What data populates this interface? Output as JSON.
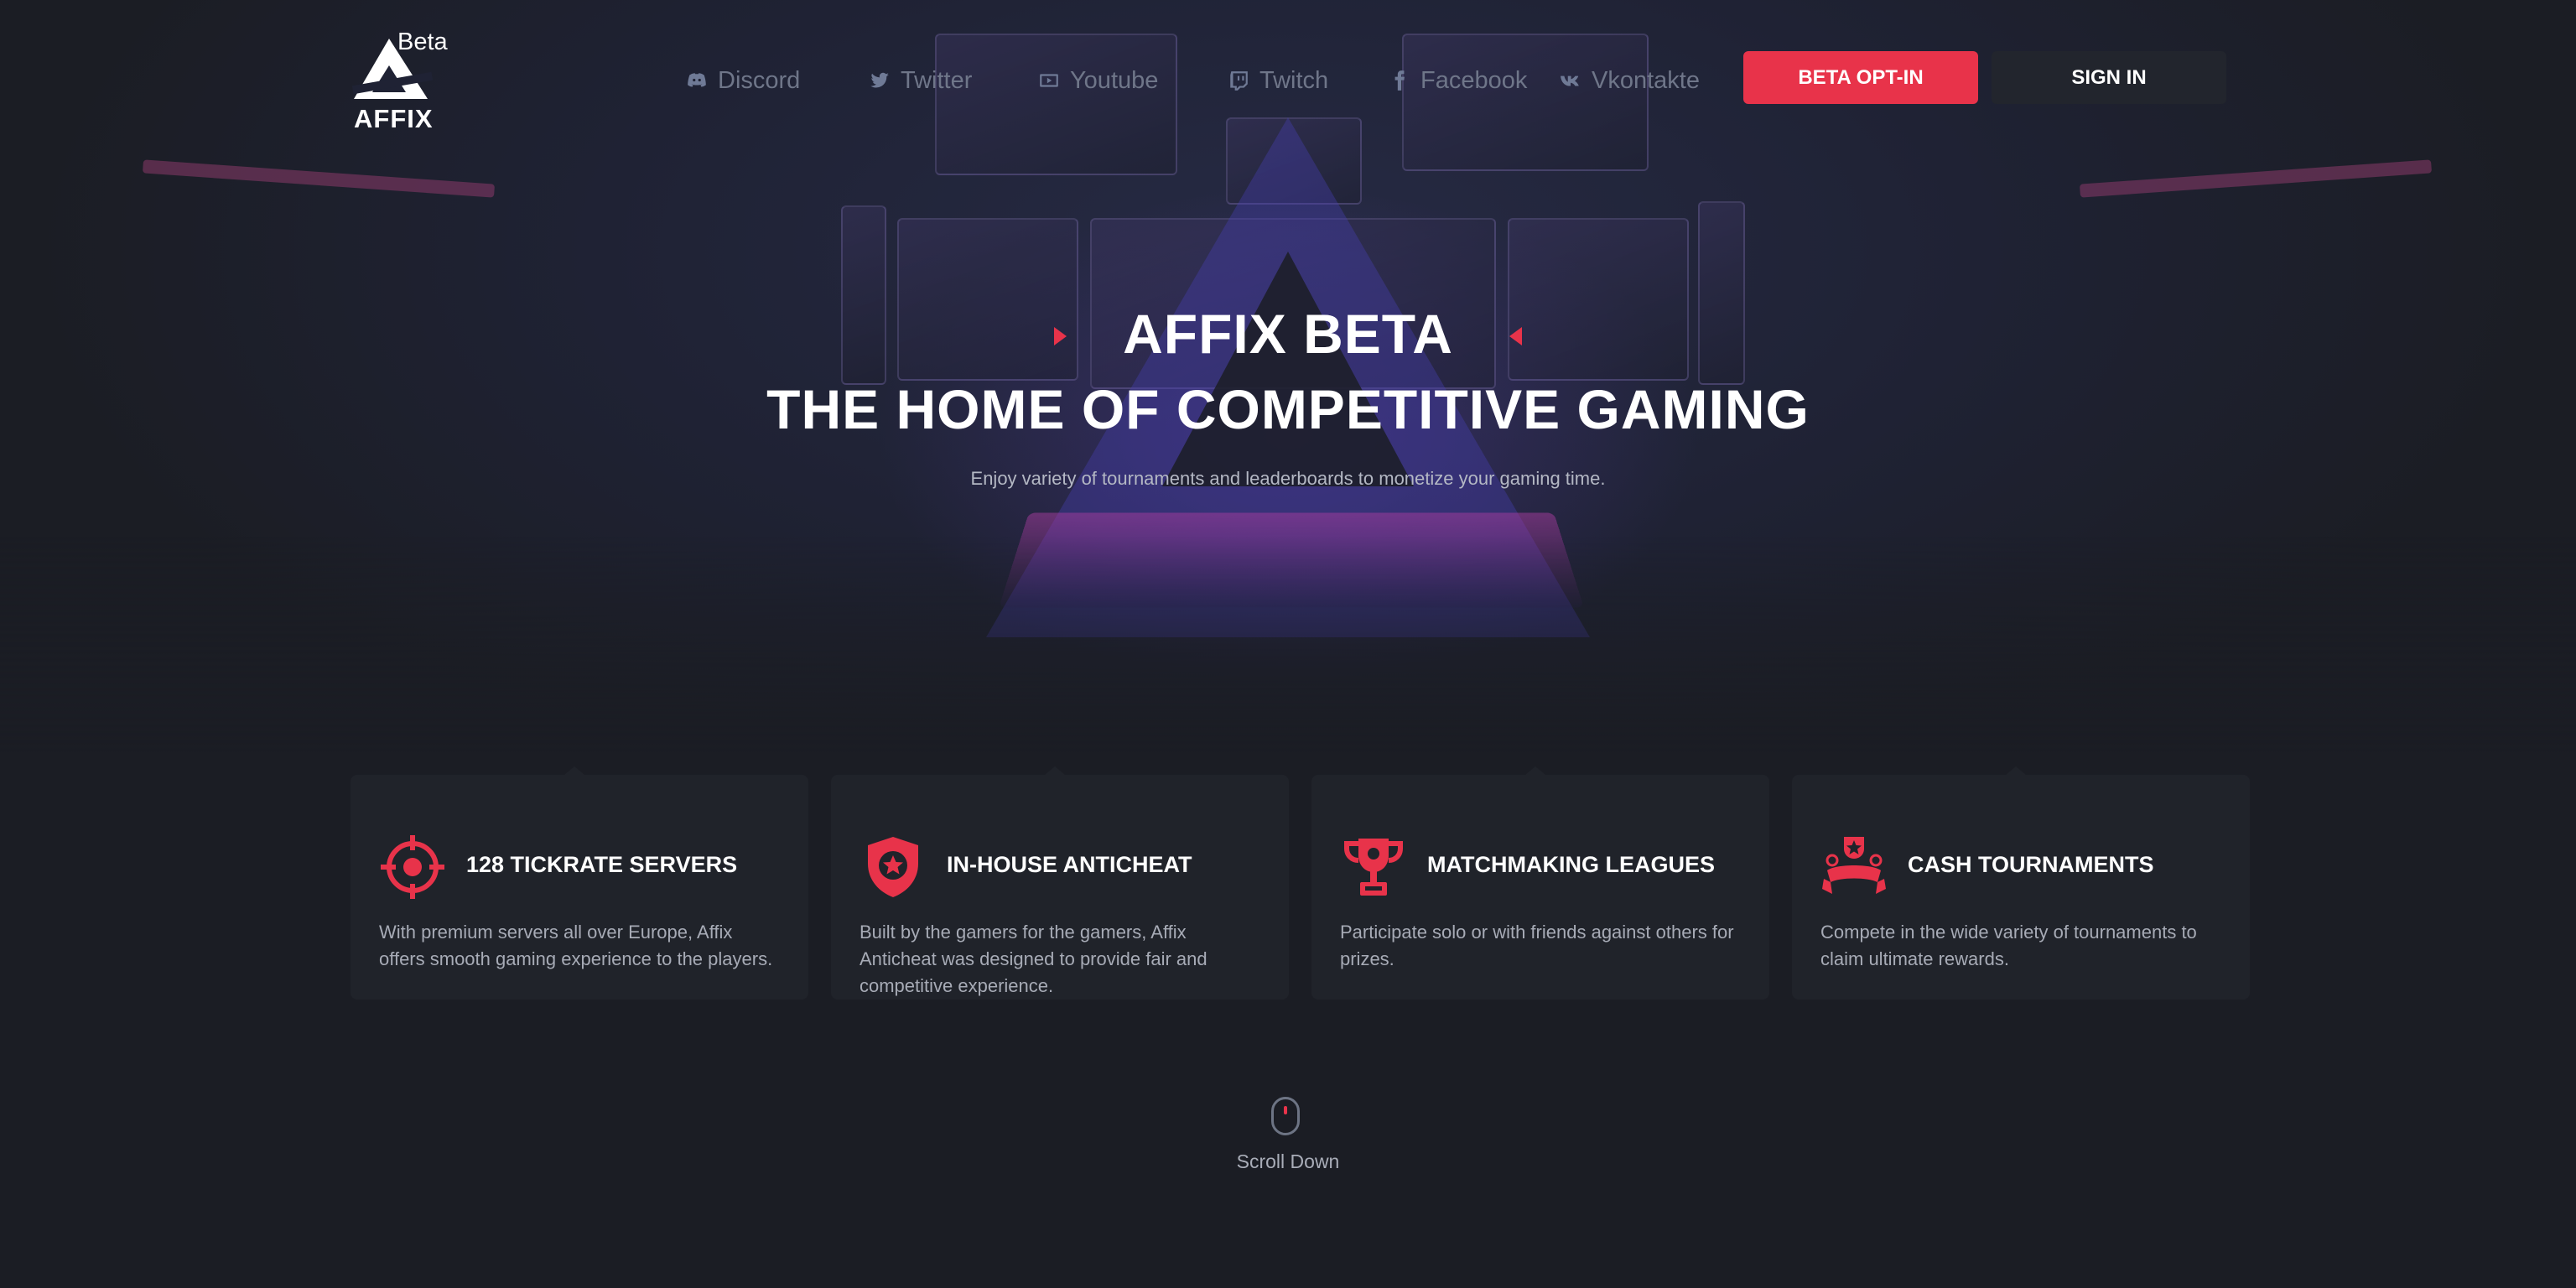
{
  "header": {
    "logo_beta": "Beta",
    "logo_text": "AFFIX",
    "nav": [
      {
        "label": "Discord",
        "icon": "discord-icon"
      },
      {
        "label": "Twitter",
        "icon": "twitter-icon"
      },
      {
        "label": "Youtube",
        "icon": "youtube-icon"
      },
      {
        "label": "Twitch",
        "icon": "twitch-icon"
      },
      {
        "label": "Facebook",
        "icon": "facebook-icon"
      },
      {
        "label": "Vkontakte",
        "icon": "vk-icon"
      }
    ],
    "optin_label": "BETA OPT-IN",
    "signin_label": "SIGN IN"
  },
  "hero": {
    "title_line1": "AFFIX BETA",
    "title_line2": "THE HOME OF COMPETITIVE GAMING",
    "subtitle": "Enjoy variety of tournaments and leaderboards to monetize your gaming time."
  },
  "features": [
    {
      "icon": "crosshair-icon",
      "title": "128 TICKRATE SERVERS",
      "desc": "With premium servers all over Europe, Affix offers smooth gaming experience to the players."
    },
    {
      "icon": "shield-star-icon",
      "title": "IN-HOUSE ANTICHEAT",
      "desc": "Built by the gamers for the gamers, Affix Anticheat was designed to provide fair and competitive experience."
    },
    {
      "icon": "trophy-icon",
      "title": "MATCHMAKING LEAGUES",
      "desc": "Participate solo or with friends against others for prizes."
    },
    {
      "icon": "prize-badge-icon",
      "title": "CASH TOURNAMENTS",
      "desc": "Compete in the wide variety of tournaments to claim ultimate rewards."
    }
  ],
  "scroll": {
    "label": "Scroll Down",
    "icon": "mouse-icon"
  },
  "colors": {
    "accent": "#e8334a",
    "background": "#1b1d24",
    "card": "#20232a",
    "nav_text": "#6f7689"
  }
}
